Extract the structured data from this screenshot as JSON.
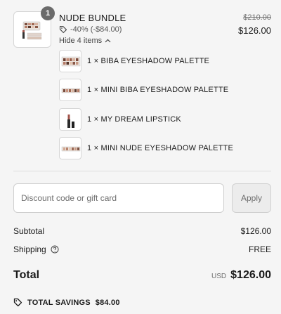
{
  "bundle": {
    "quantity": "1",
    "title": "NUDE BUNDLE",
    "discount": "-40% (-$84.00)",
    "price_original": "$210.00",
    "price_current": "$126.00",
    "toggle_label": "Hide 4 items",
    "items": [
      {
        "label": "1 × BIBA EYESHADOW PALETTE"
      },
      {
        "label": "1 × MINI BIBA EYESHADOW PALETTE"
      },
      {
        "label": "1 × MY DREAM LIPSTICK"
      },
      {
        "label": "1 × MINI NUDE EYESHADOW PALETTE"
      }
    ]
  },
  "discount_form": {
    "placeholder": "Discount code or gift card",
    "value": "",
    "apply_label": "Apply"
  },
  "summary": {
    "subtotal_label": "Subtotal",
    "subtotal_value": "$126.00",
    "shipping_label": "Shipping",
    "shipping_value": "FREE",
    "total_label": "Total",
    "currency": "USD",
    "total_value": "$126.00",
    "savings_label": "TOTAL SAVINGS",
    "savings_value": "$84.00"
  },
  "icons": {
    "tag": "tag-icon",
    "chevron": "chevron-up-icon",
    "help": "help-circle-icon",
    "savings": "savings-tag-icon"
  },
  "colors": {
    "background": "#f5f5f5",
    "badge": "#6b6b6b",
    "text": "#1a1a1a",
    "muted": "#6e6e6e"
  }
}
